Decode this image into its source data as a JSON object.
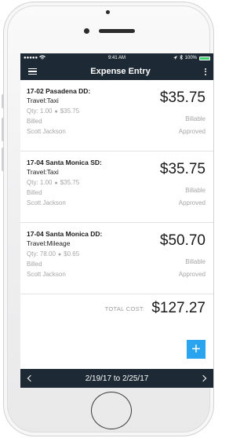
{
  "status_bar": {
    "signal": "●●●●●",
    "time": "9:41 AM",
    "battery_text": "100%"
  },
  "header": {
    "title": "Expense Entry"
  },
  "entries": [
    {
      "title": "17-02 Pasadena DD:",
      "category": "Travel:Taxi",
      "qty": "Qty: 1.00",
      "rate": "$35.75",
      "billed": "Billed",
      "person": "Scott Jackson",
      "amount": "$35.75",
      "billable": "Billable",
      "status": "Approved"
    },
    {
      "title": "17-04 Santa Monica SD:",
      "category": "Travel:Taxi",
      "qty": "Qty: 1.00",
      "rate": "$35.75",
      "billed": "Billed",
      "person": "Scott Jackson",
      "amount": "$35.75",
      "billable": "Billable",
      "status": "Approved"
    },
    {
      "title": "17-04 Santa Monica DD:",
      "category": "Travel:Mileage",
      "qty": "Qty: 78.00",
      "rate": "$0.65",
      "billed": "Billed",
      "person": "Scott Jackson",
      "amount": "$50.70",
      "billable": "Billable",
      "status": "Approved"
    }
  ],
  "total": {
    "label": "TOTAL COST:",
    "value": "$127.27"
  },
  "add_button": {
    "icon": "plus-icon",
    "symbol": "+"
  },
  "footer": {
    "date_range": "2/19/17 to 2/25/17"
  },
  "colors": {
    "nav_bg": "#1d2a35",
    "accent": "#2aa4ef",
    "muted_text": "#a6a6a6"
  }
}
